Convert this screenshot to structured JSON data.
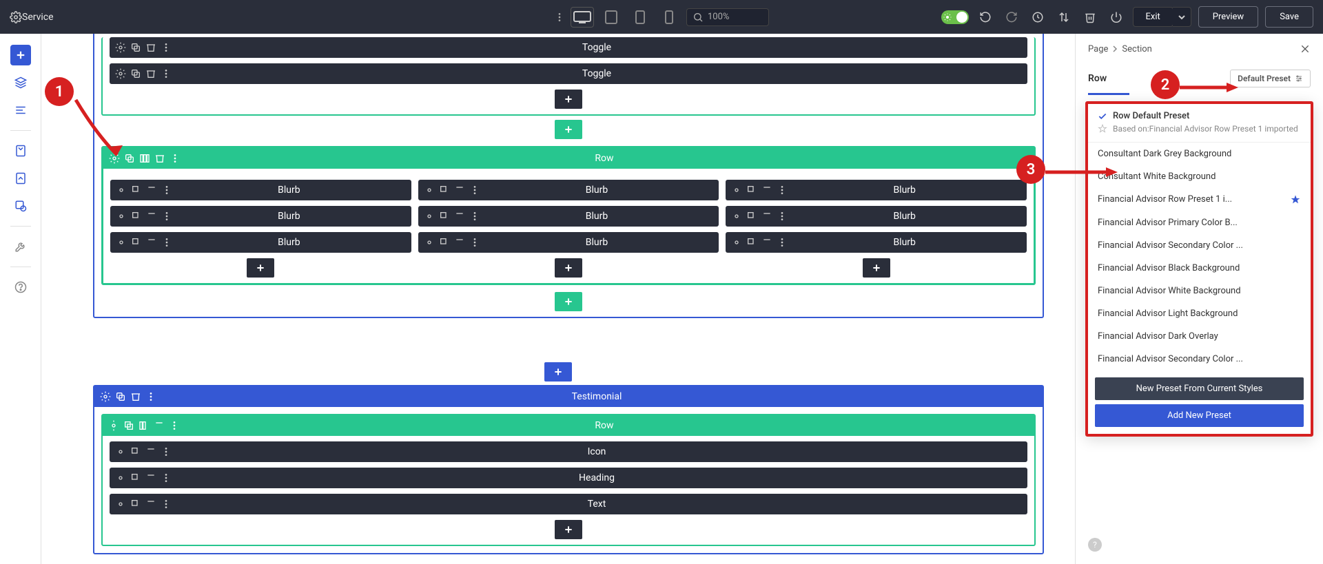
{
  "topbar": {
    "title": "Service",
    "zoom": "100%",
    "exit": "Exit",
    "preview": "Preview",
    "save": "Save"
  },
  "leftbar": {},
  "canvas": {
    "section1": {
      "toggles": [
        "Toggle",
        "Toggle"
      ],
      "row_label": "Row",
      "blurb": "Blurb"
    },
    "section2": {
      "label": "Testimonial",
      "row_label": "Row",
      "mods": [
        "Icon",
        "Heading",
        "Text"
      ]
    }
  },
  "right": {
    "crumb_page": "Page",
    "crumb_section": "Section",
    "title": "Row",
    "default_preset": "Default Preset",
    "dd_title": "Row Default Preset",
    "dd_sub": "Based on:Financial Advisor Row Preset 1 imported",
    "items": [
      "Consultant Dark Grey Background",
      "Consultant White Background",
      "Financial Advisor Row Preset 1 i...",
      "Financial Advisor Primary Color B...",
      "Financial Advisor Secondary Color ...",
      "Financial Advisor Black Background",
      "Financial Advisor White Background",
      "Financial Advisor Light Background",
      "Financial Advisor Dark Overlay",
      "Financial Advisor Secondary Color ..."
    ],
    "new_preset": "New Preset From Current Styles",
    "add_preset": "Add New Preset"
  },
  "annotations": {
    "n1": "1",
    "n2": "2",
    "n3": "3"
  }
}
